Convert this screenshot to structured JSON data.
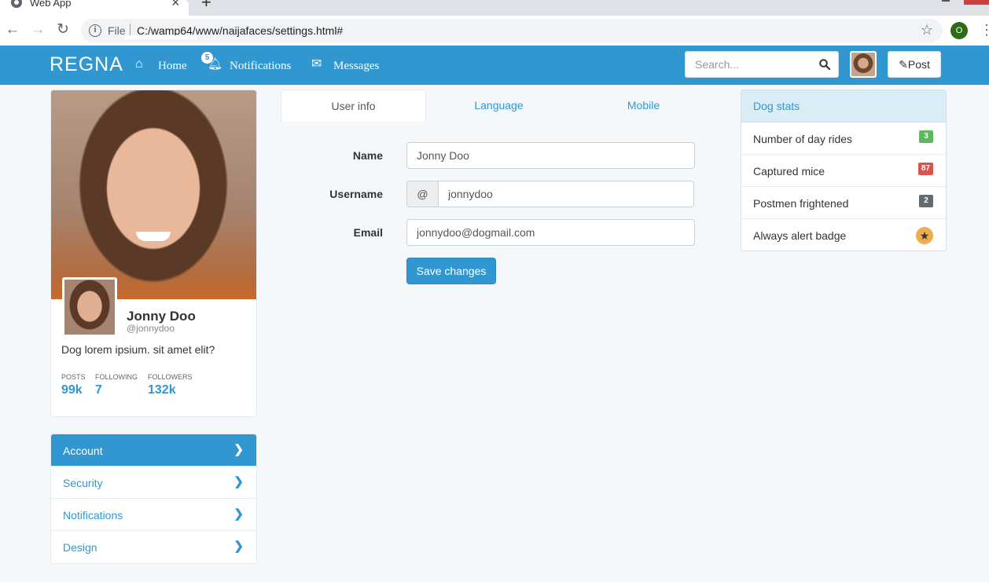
{
  "browser": {
    "tab_title": "Web App",
    "url_scheme": "File",
    "url": "C:/wamp64/www/naijafaces/settings.html#",
    "profile_initial": "O"
  },
  "nav": {
    "brand": "REGNA",
    "home": "Home",
    "notifications": "Notifications",
    "notifications_count": "5",
    "messages": "Messages",
    "search_placeholder": "Search...",
    "post": "Post"
  },
  "profile": {
    "name": "Jonny Doo",
    "handle": "@jonnydoo",
    "bio": "Dog lorem ipsium. sit amet elit?",
    "stats": [
      {
        "label": "POSTS",
        "value": "99k"
      },
      {
        "label": "FOLLOWING",
        "value": "7"
      },
      {
        "label": "FOLLOWERS",
        "value": "132k"
      }
    ]
  },
  "side_menu": [
    {
      "label": "Account",
      "active": true
    },
    {
      "label": "Security"
    },
    {
      "label": "Notifications"
    },
    {
      "label": "Design"
    }
  ],
  "tabs": [
    {
      "label": "User info",
      "active": true
    },
    {
      "label": "Language"
    },
    {
      "label": "Mobile"
    }
  ],
  "form": {
    "name_label": "Name",
    "name_value": "Jonny Doo",
    "username_label": "Username",
    "username_addon": "@",
    "username_value": "jonnydoo",
    "email_label": "Email",
    "email_value": "jonnydoo@dogmail.com",
    "save": "Save changes"
  },
  "dog_stats": {
    "title": "Dog stats",
    "rows": [
      {
        "label": "Number of day rides",
        "badge": "3",
        "color": "#5cb85c"
      },
      {
        "label": "Captured mice",
        "badge": "87",
        "color": "#d9534f"
      },
      {
        "label": "Postmen frightened",
        "badge": "2",
        "color": "#636b6f"
      },
      {
        "label": "Always alert badge",
        "badge": "★",
        "color": "#f0ad4e"
      }
    ]
  }
}
